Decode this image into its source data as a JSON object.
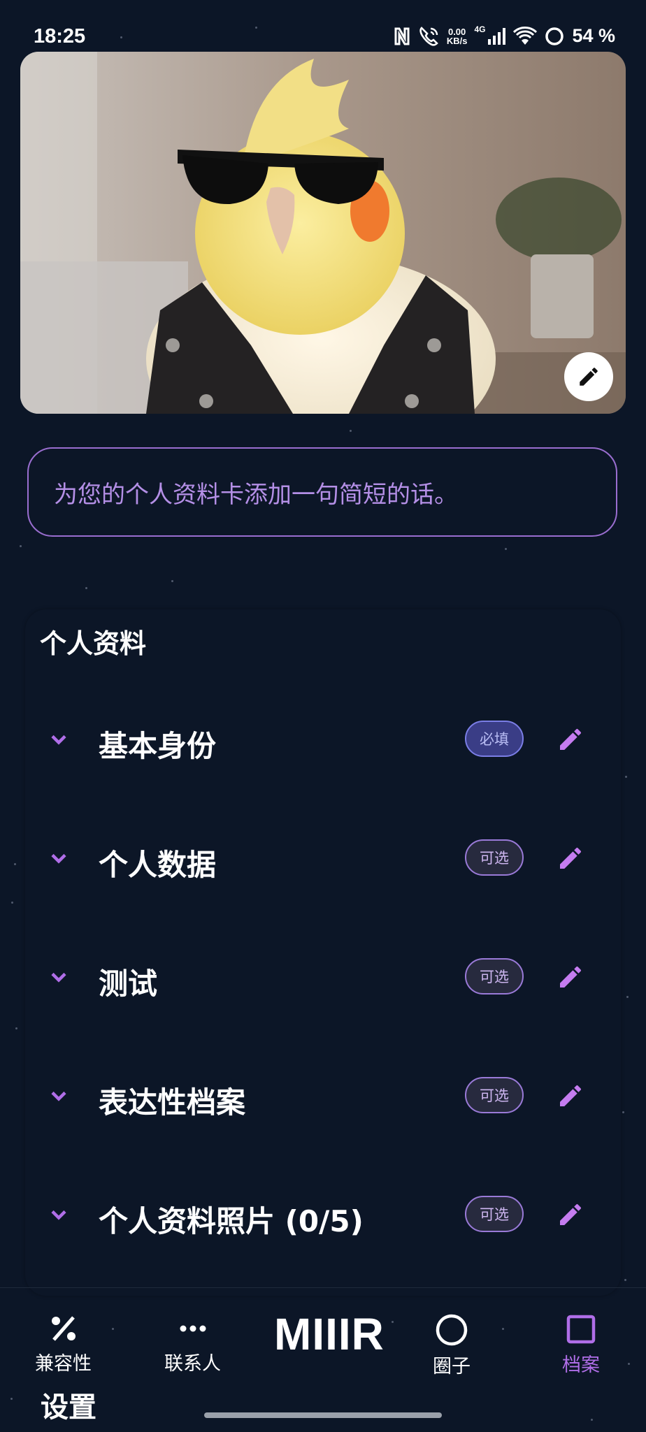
{
  "status_bar": {
    "time": "18:25",
    "net_speed_value": "0.00",
    "net_speed_unit": "KB/s",
    "network_type": "4G",
    "battery": "54 %"
  },
  "tagline": {
    "placeholder": "为您的个人资料卡添加一句简短的话。"
  },
  "profile": {
    "title": "个人资料",
    "sections": [
      {
        "label": "基本身份",
        "badge": "必填",
        "required": true
      },
      {
        "label": "个人数据",
        "badge": "可选",
        "required": false
      },
      {
        "label": "测试",
        "badge": "可选",
        "required": false
      },
      {
        "label": "表达性档案",
        "badge": "可选",
        "required": false
      },
      {
        "label": "个人资料照片 (0/5)",
        "badge": "可选",
        "required": false
      }
    ]
  },
  "bottom_nav": {
    "compatibility": "兼容性",
    "contacts": "联系人",
    "brand": "MIIIR",
    "circle": "圈子",
    "profile": "档案",
    "settings": "设置"
  },
  "colors": {
    "background": "#0c1627",
    "accent": "#b06ee8",
    "badge_required": "#3a3d86"
  }
}
